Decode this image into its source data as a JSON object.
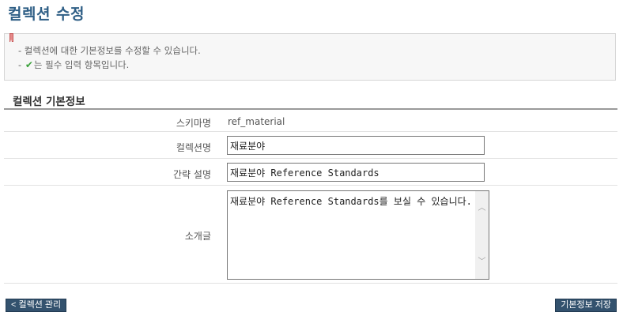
{
  "page": {
    "title": "컬렉션 수정"
  },
  "info": {
    "line1": "- 컬렉션에 대한 기본정보를 수정할 수 있습니다.",
    "line2_prefix": "- ",
    "line2_suffix": "는 필수 입력 항목입니다."
  },
  "section": {
    "title": "컬렉션 기본정보"
  },
  "form": {
    "schema_label": "스키마명",
    "schema_value": "ref_material",
    "name_label": "컬렉션명",
    "name_value": "재료분야",
    "desc_label": "간략 설명",
    "desc_value": "재료분야 Reference Standards",
    "intro_label": "소개글",
    "intro_value": "재료분야 Reference Standards를 보실 수 있습니다."
  },
  "buttons": {
    "back_label": "< 컬렉션 관리",
    "save_label": "기본정보 저장"
  },
  "colors": {
    "title": "#2f5f86",
    "button_bg": "#33526e",
    "check": "#3aa13a"
  },
  "icons": {
    "bookmark": "bookmark-icon",
    "check": "check-icon",
    "scroll_up": "chevron-up-icon",
    "scroll_down": "chevron-down-icon"
  }
}
